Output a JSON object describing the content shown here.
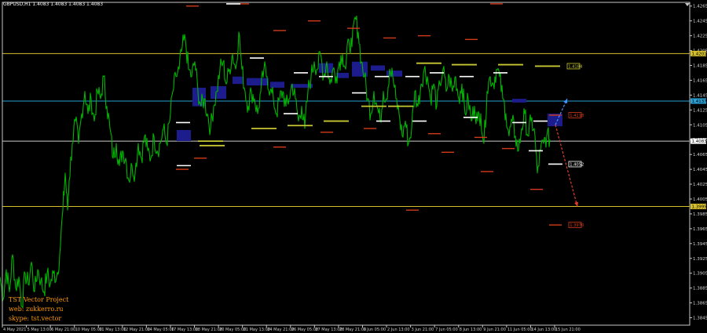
{
  "header": {
    "symbol_info": "GBPUSD,H1  1.4083 1.4083 1.4083 1.4083"
  },
  "branding": {
    "line1": "TST Vector Project",
    "line2": "web: zukkerro.ru",
    "line3": "skype: tst.vector"
  },
  "colors": {
    "background": "#000000",
    "price_line": "#00b400",
    "frame": "#c8c8c8",
    "level_yellow": "#d6c02a",
    "level_blue": "#2aa0d6",
    "box_fill": "#1c1c8c",
    "red_marks": "#d23a1a",
    "white_marks": "#ffffff",
    "gold_marks": "#c8c832",
    "arrow_red": "#e03c28",
    "arrow_blue": "#3c96ff"
  },
  "chart_data": {
    "type": "line",
    "ylim": [
      1.3835,
      1.427
    ],
    "y_ticks": [
      "1.4265",
      "1.4245",
      "1.4225",
      "1.4205",
      "1.4185",
      "1.4165",
      "1.4145",
      "1.4125",
      "1.4105",
      "1.4085",
      "1.4065",
      "1.4045",
      "1.4025",
      "1.4005",
      "1.3985",
      "1.3965",
      "1.3945",
      "1.3925",
      "1.3905",
      "1.3885",
      "1.3865",
      "1.3845",
      "1.3825"
    ],
    "x_labels": [
      "4 May 2021",
      "5 May 13:00",
      "6 May 21:00",
      "10 May 05:00",
      "11 May 13:00",
      "12 May 21:00",
      "14 May 05:00",
      "17 May 13:00",
      "18 May 21:00",
      "20 May 05:00",
      "21 May 13:00",
      "24 May 21:00",
      "26 May 05:00",
      "27 May 13:00",
      "28 May 21:00",
      "1 Jun 05:00",
      "2 Jun 13:00",
      "3 Jun 21:00",
      "7 Jun 05:00",
      "8 Jun 13:00",
      "9 Jun 21:00",
      "11 Jun 05:00",
      "14 Jun 13:00",
      "15 Jun 21:00"
    ],
    "horizontal_levels": [
      {
        "price": 1.4201,
        "label": "1.4201",
        "color": "yellow"
      },
      {
        "price": 1.4137,
        "label": "1.4137",
        "color": "blue"
      },
      {
        "price": 1.4083,
        "label": "1.4083",
        "color": "white"
      },
      {
        "price": 1.3995,
        "label": "1.3995",
        "color": "yellow"
      }
    ],
    "projection_labels": [
      {
        "price": 1.4184,
        "label": "1.4184",
        "color": "gold"
      },
      {
        "price": 1.4118,
        "label": "1.4118",
        "color": "red"
      },
      {
        "price": 1.4052,
        "label": "1.4052",
        "color": "white"
      },
      {
        "price": 1.397,
        "label": "1.3970",
        "color": "red"
      }
    ],
    "price_path": [
      [
        0,
        1.39
      ],
      [
        4,
        1.387
      ],
      [
        8,
        1.391
      ],
      [
        12,
        1.388
      ],
      [
        16,
        1.393
      ],
      [
        20,
        1.3885
      ],
      [
        24,
        1.39
      ],
      [
        28,
        1.386
      ],
      [
        32,
        1.3905
      ],
      [
        36,
        1.389
      ],
      [
        40,
        1.392
      ],
      [
        44,
        1.388
      ],
      [
        48,
        1.391
      ],
      [
        52,
        1.3895
      ],
      [
        56,
        1.388
      ],
      [
        60,
        1.3905
      ],
      [
        64,
        1.389
      ],
      [
        68,
        1.3905
      ],
      [
        72,
        1.39
      ],
      [
        76,
        1.393
      ],
      [
        80,
        1.399
      ],
      [
        83,
        1.404
      ],
      [
        86,
        1.399
      ],
      [
        88,
        1.403
      ],
      [
        92,
        1.408
      ],
      [
        96,
        1.411
      ],
      [
        100,
        1.408
      ],
      [
        104,
        1.412
      ],
      [
        108,
        1.415
      ],
      [
        112,
        1.412
      ],
      [
        116,
        1.414
      ],
      [
        120,
        1.411
      ],
      [
        124,
        1.415
      ],
      [
        128,
        1.414
      ],
      [
        132,
        1.417
      ],
      [
        136,
        1.413
      ],
      [
        140,
        1.41
      ],
      [
        144,
        1.406
      ],
      [
        148,
        1.408
      ],
      [
        152,
        1.405
      ],
      [
        156,
        1.407
      ],
      [
        160,
        1.406
      ],
      [
        164,
        1.403
      ],
      [
        168,
        1.405
      ],
      [
        172,
        1.404
      ],
      [
        176,
        1.408
      ],
      [
        180,
        1.406
      ],
      [
        184,
        1.409
      ],
      [
        188,
        1.407
      ],
      [
        192,
        1.406
      ],
      [
        196,
        1.409
      ],
      [
        200,
        1.407
      ],
      [
        204,
        1.408
      ],
      [
        208,
        1.41
      ],
      [
        212,
        1.408
      ],
      [
        216,
        1.411
      ],
      [
        220,
        1.415
      ],
      [
        224,
        1.417
      ],
      [
        228,
        1.418
      ],
      [
        232,
        1.421
      ],
      [
        236,
        1.422
      ],
      [
        240,
        1.418
      ],
      [
        244,
        1.417
      ],
      [
        248,
        1.419
      ],
      [
        252,
        1.415
      ],
      [
        256,
        1.413
      ],
      [
        260,
        1.414
      ],
      [
        264,
        1.412
      ],
      [
        268,
        1.41
      ],
      [
        272,
        1.413
      ],
      [
        276,
        1.415
      ],
      [
        280,
        1.418
      ],
      [
        284,
        1.419
      ],
      [
        288,
        1.416
      ],
      [
        292,
        1.418
      ],
      [
        296,
        1.42
      ],
      [
        300,
        1.418
      ],
      [
        304,
        1.423
      ],
      [
        308,
        1.418
      ],
      [
        312,
        1.415
      ],
      [
        316,
        1.413
      ],
      [
        320,
        1.415
      ],
      [
        324,
        1.414
      ],
      [
        328,
        1.412
      ],
      [
        332,
        1.415
      ],
      [
        336,
        1.418
      ],
      [
        340,
        1.417
      ],
      [
        344,
        1.415
      ],
      [
        348,
        1.414
      ],
      [
        352,
        1.412
      ],
      [
        356,
        1.414
      ],
      [
        360,
        1.415
      ],
      [
        364,
        1.413
      ],
      [
        368,
        1.414
      ],
      [
        372,
        1.416
      ],
      [
        376,
        1.414
      ],
      [
        380,
        1.411
      ],
      [
        384,
        1.413
      ],
      [
        388,
        1.41
      ],
      [
        392,
        1.415
      ],
      [
        396,
        1.417
      ],
      [
        400,
        1.419
      ],
      [
        404,
        1.418
      ],
      [
        408,
        1.42
      ],
      [
        412,
        1.417
      ],
      [
        416,
        1.419
      ],
      [
        420,
        1.416
      ],
      [
        424,
        1.418
      ],
      [
        428,
        1.417
      ],
      [
        432,
        1.419
      ],
      [
        436,
        1.42
      ],
      [
        440,
        1.418
      ],
      [
        444,
        1.422
      ],
      [
        448,
        1.421
      ],
      [
        452,
        1.425
      ],
      [
        456,
        1.423
      ],
      [
        460,
        1.419
      ],
      [
        464,
        1.417
      ],
      [
        468,
        1.414
      ],
      [
        472,
        1.412
      ],
      [
        476,
        1.415
      ],
      [
        480,
        1.413
      ],
      [
        484,
        1.411
      ],
      [
        488,
        1.415
      ],
      [
        492,
        1.414
      ],
      [
        496,
        1.418
      ],
      [
        500,
        1.417
      ],
      [
        504,
        1.414
      ],
      [
        508,
        1.412
      ],
      [
        512,
        1.409
      ],
      [
        516,
        1.411
      ],
      [
        520,
        1.408
      ],
      [
        524,
        1.41
      ],
      [
        528,
        1.415
      ],
      [
        532,
        1.413
      ],
      [
        536,
        1.416
      ],
      [
        540,
        1.418
      ],
      [
        544,
        1.417
      ],
      [
        548,
        1.414
      ],
      [
        552,
        1.416
      ],
      [
        556,
        1.413
      ],
      [
        560,
        1.416
      ],
      [
        564,
        1.418
      ],
      [
        568,
        1.415
      ],
      [
        572,
        1.417
      ],
      [
        576,
        1.415
      ],
      [
        580,
        1.417
      ],
      [
        584,
        1.414
      ],
      [
        588,
        1.416
      ],
      [
        592,
        1.412
      ],
      [
        596,
        1.414
      ],
      [
        600,
        1.411
      ],
      [
        604,
        1.413
      ],
      [
        608,
        1.411
      ],
      [
        612,
        1.412
      ],
      [
        616,
        1.408
      ],
      [
        620,
        1.415
      ],
      [
        624,
        1.417
      ],
      [
        628,
        1.416
      ],
      [
        632,
        1.418
      ],
      [
        636,
        1.417
      ],
      [
        640,
        1.414
      ],
      [
        644,
        1.412
      ],
      [
        648,
        1.409
      ],
      [
        652,
        1.411
      ],
      [
        656,
        1.409
      ],
      [
        660,
        1.407
      ],
      [
        664,
        1.41
      ],
      [
        668,
        1.412
      ],
      [
        672,
        1.409
      ],
      [
        676,
        1.411
      ],
      [
        680,
        1.41
      ],
      [
        684,
        1.404
      ],
      [
        688,
        1.407
      ],
      [
        692,
        1.408
      ],
      [
        696,
        1.409
      ],
      [
        700,
        1.4085
      ]
    ],
    "red_marks": [
      [
        245,
        1.4265
      ],
      [
        309,
        1.4268
      ],
      [
        356,
        1.4232
      ],
      [
        400,
        1.4245
      ],
      [
        450,
        1.4235
      ],
      [
        496,
        1.4222
      ],
      [
        540,
        1.4225
      ],
      [
        600,
        1.422
      ],
      [
        632,
        1.4268
      ],
      [
        232,
        1.4045
      ],
      [
        255,
        1.406
      ],
      [
        356,
        1.4075
      ],
      [
        416,
        1.4095
      ],
      [
        471,
        1.41
      ],
      [
        553,
        1.4093
      ],
      [
        570,
        1.4068
      ],
      [
        612,
        1.4088
      ],
      [
        620,
        1.4042
      ],
      [
        683,
        1.4018
      ],
      [
        525,
        1.399
      ],
      [
        647,
        1.4073
      ],
      [
        707,
        1.4118
      ],
      [
        707,
        1.397
      ]
    ],
    "white_marks": [
      [
        297,
        1.4268
      ],
      [
        327,
        1.4195
      ],
      [
        383,
        1.4175
      ],
      [
        415,
        1.417
      ],
      [
        457,
        1.4148
      ],
      [
        486,
        1.417
      ],
      [
        525,
        1.417
      ],
      [
        556,
        1.4175
      ],
      [
        594,
        1.417
      ],
      [
        637,
        1.4175
      ],
      [
        661,
        1.4108
      ],
      [
        688,
        1.411
      ],
      [
        233,
        1.4108
      ],
      [
        234,
        1.405
      ],
      [
        370,
        1.412
      ],
      [
        488,
        1.411
      ],
      [
        534,
        1.411
      ],
      [
        599,
        1.4115
      ],
      [
        682,
        1.407
      ],
      [
        707,
        1.4052
      ]
    ],
    "gold_marks": [
      [
        268,
        1.4083
      ],
      [
        336,
        1.41
      ],
      [
        428,
        1.411
      ],
      [
        476,
        1.413
      ],
      [
        510,
        1.413
      ],
      [
        546,
        1.4188
      ],
      [
        591,
        1.4186
      ],
      [
        650,
        1.4186
      ],
      [
        697,
        1.4184
      ],
      [
        270,
        1.4077
      ],
      [
        382,
        1.4104
      ]
    ],
    "boxes": [
      {
        "x0": 225,
        "x1": 243,
        "p_top": 1.4098,
        "p_bot": 1.4083
      },
      {
        "x0": 245,
        "x1": 262,
        "p_top": 1.4155,
        "p_bot": 1.413
      },
      {
        "x0": 268,
        "x1": 288,
        "p_top": 1.4157,
        "p_bot": 1.414
      },
      {
        "x0": 296,
        "x1": 310,
        "p_top": 1.417,
        "p_bot": 1.416
      },
      {
        "x0": 314,
        "x1": 342,
        "p_top": 1.4168,
        "p_bot": 1.4158
      },
      {
        "x0": 344,
        "x1": 362,
        "p_top": 1.4163,
        "p_bot": 1.4155
      },
      {
        "x0": 370,
        "x1": 398,
        "p_top": 1.416,
        "p_bot": 1.4155
      },
      {
        "x0": 406,
        "x1": 424,
        "p_top": 1.4188,
        "p_bot": 1.4175
      },
      {
        "x0": 428,
        "x1": 444,
        "p_top": 1.4175,
        "p_bot": 1.4168
      },
      {
        "x0": 448,
        "x1": 468,
        "p_top": 1.419,
        "p_bot": 1.417
      },
      {
        "x0": 472,
        "x1": 490,
        "p_top": 1.4185,
        "p_bot": 1.4178
      },
      {
        "x0": 492,
        "x1": 512,
        "p_top": 1.4178,
        "p_bot": 1.417
      },
      {
        "x0": 652,
        "x1": 670,
        "p_top": 1.414,
        "p_bot": 1.4135
      },
      {
        "x0": 697,
        "x1": 716,
        "p_top": 1.412,
        "p_bot": 1.4103
      }
    ],
    "forecast_arrows": [
      {
        "from": [
          707,
          1.4105
        ],
        "to": [
          722,
          1.414
        ],
        "color": "blue"
      },
      {
        "from": [
          707,
          1.4105
        ],
        "to": [
          735,
          1.3995
        ],
        "color": "red"
      }
    ]
  }
}
